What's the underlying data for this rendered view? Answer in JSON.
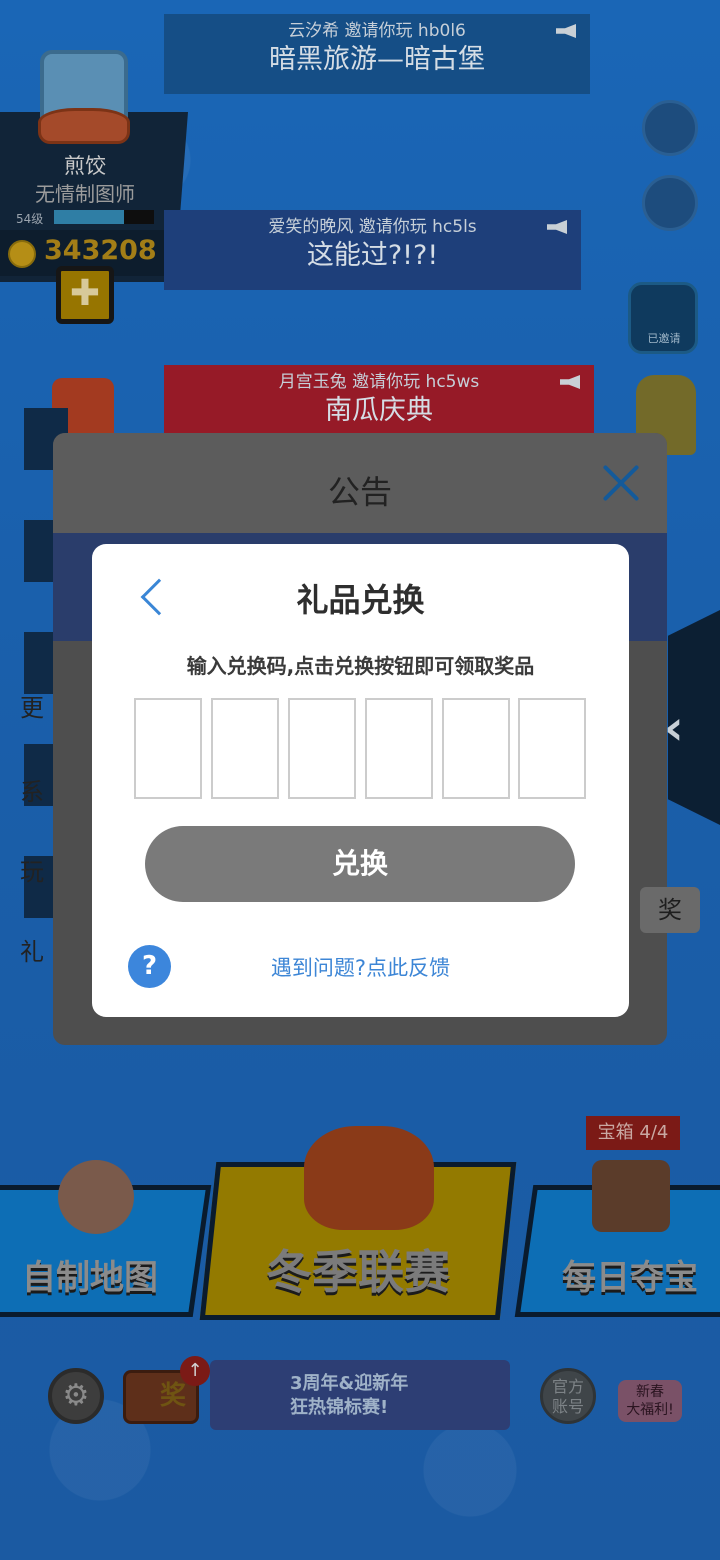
{
  "profile": {
    "name": "煎饺",
    "title": "无情制图师",
    "level": "54级",
    "level_progress": 0.7,
    "coins": "343208",
    "add_label": "✚"
  },
  "invites": [
    {
      "who": "云汐希 邀请你玩 hb0l6",
      "room": "暗黑旅游—暗古堡"
    },
    {
      "who": "爱笑的晚风 邀请你玩 hc5ls",
      "room": "这能过?!?!"
    },
    {
      "who": "月宫玉兔 邀请你玩 hc5ws",
      "room": "南瓜庆典"
    }
  ],
  "side": {
    "invited_label": "已邀请"
  },
  "announcement": {
    "title": "公告",
    "items": [
      "更",
      "系",
      "玩",
      "礼"
    ],
    "tag": "奖"
  },
  "modes": {
    "left": "自制地图",
    "center": "冬季联赛",
    "right": "每日夺宝",
    "chest_tag": "宝箱 4/4"
  },
  "bottom_bar": {
    "settings_icon": "⚙",
    "reward_label": "奖",
    "reward_alert": "↑",
    "event_line1": "3周年&迎新年",
    "event_line2": "狂热锦标赛!",
    "official_line1": "官方",
    "official_line2": "账号",
    "spring_line1": "新春",
    "spring_line2": "大福利!"
  },
  "redeem_dialog": {
    "title": "礼品兑换",
    "hint": "输入兑换码,点击兑换按钮即可领取奖品",
    "button_label": "兑换",
    "help_label": "?",
    "feedback_label": "遇到问题?点此反馈",
    "code_slots": [
      "",
      "",
      "",
      "",
      "",
      ""
    ]
  },
  "colors": {
    "background": "#1b5fa6",
    "accent_blue": "#3a86d6",
    "button_disabled": "#7a7a7a"
  }
}
